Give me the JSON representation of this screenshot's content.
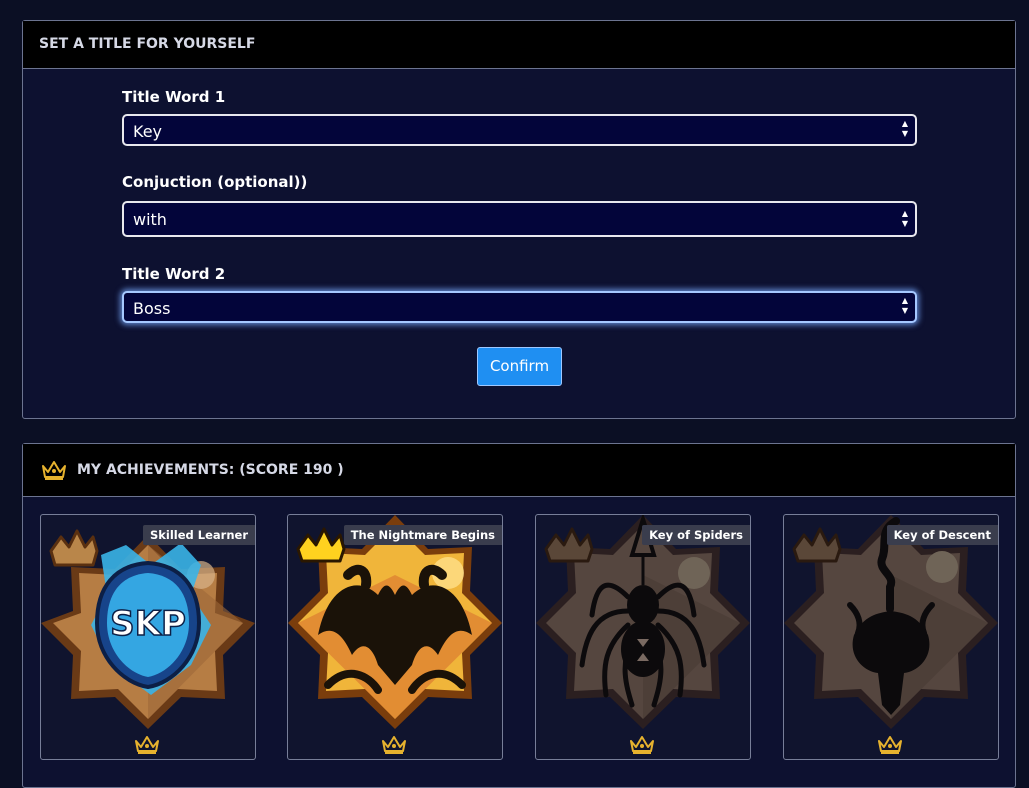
{
  "title_panel": {
    "heading": "SET A TITLE FOR YOURSELF",
    "fields": [
      {
        "label": "Title Word 1",
        "value": "Key"
      },
      {
        "label": "Conjuction (optional))",
        "value": "with"
      },
      {
        "label": "Title Word 2",
        "value": "Boss"
      }
    ],
    "confirm_label": "Confirm"
  },
  "achievements_panel": {
    "heading": "MY ACHIEVEMENTS: (SCORE 190 )",
    "cards": [
      {
        "name": "Skilled Learner",
        "icon": "skp-shield-icon",
        "unlocked": true,
        "emblem_text": "SKP"
      },
      {
        "name": "The Nightmare Begins",
        "icon": "nightmare-bat-icon",
        "unlocked": true
      },
      {
        "name": "Key of Spiders",
        "icon": "spider-icon",
        "unlocked": false
      },
      {
        "name": "Key of Descent",
        "icon": "descent-key-icon",
        "unlocked": false
      }
    ]
  },
  "colors": {
    "accent_blue": "#1f8ff2",
    "crown_gold": "#e6b22e",
    "background": "#0b0f24"
  }
}
